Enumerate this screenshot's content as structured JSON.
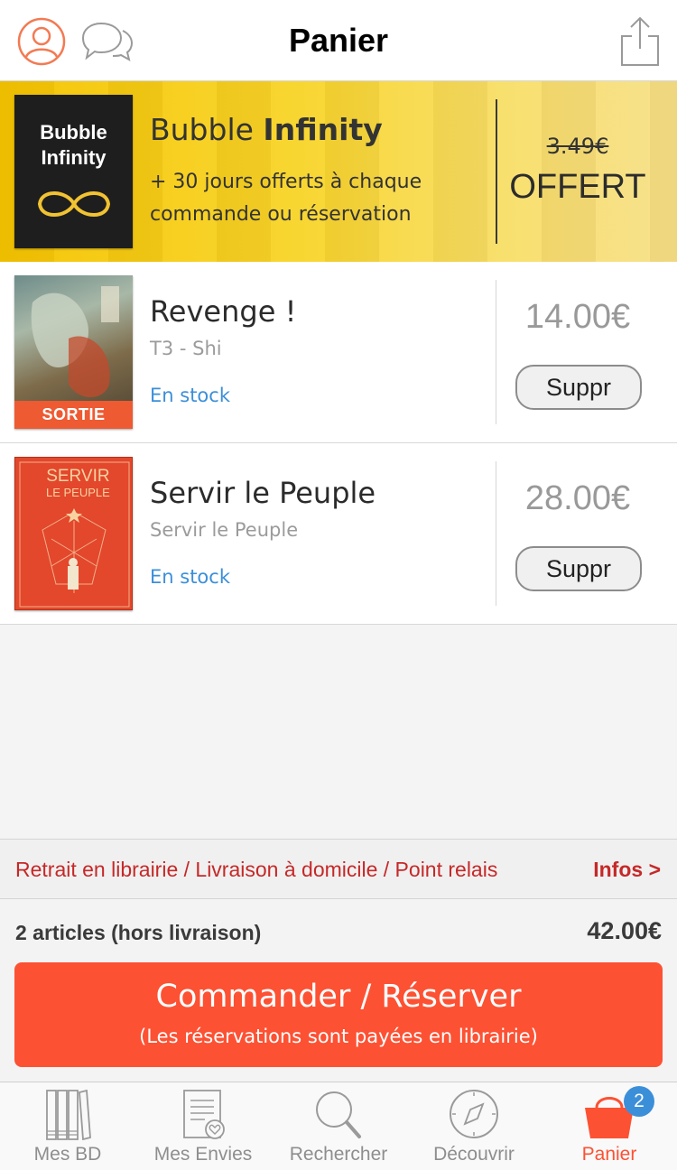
{
  "header": {
    "title": "Panier",
    "left_icons": [
      "user-icon",
      "chat-icon"
    ],
    "right_icon": "share-icon"
  },
  "promo": {
    "cover_title_line1": "Bubble",
    "cover_title_line2": "Infinity",
    "title_regular": "Bubble",
    "title_bold": "Infinity",
    "description": "+ 30 jours offerts à chaque commande ou réservation",
    "old_price": "3.49€",
    "price_label": "OFFERT"
  },
  "items": [
    {
      "title": "Revenge !",
      "subtitle": "T3 - Shi",
      "stock": "En stock",
      "price": "14.00€",
      "remove_label": "Suppr",
      "cover_badge": "SORTIE"
    },
    {
      "title": "Servir le Peuple",
      "subtitle": "Servir le Peuple",
      "stock": "En stock",
      "price": "28.00€",
      "remove_label": "Suppr",
      "cover_text_line1": "SERVIR",
      "cover_text_line2": "LE PEUPLE"
    }
  ],
  "delivery": {
    "text": "Retrait en librairie / Livraison à domicile / Point relais",
    "infos_link": "Infos >"
  },
  "summary": {
    "count": "2 articles (hors livraison)",
    "total": "42.00€"
  },
  "order_button": {
    "main": "Commander / Réserver",
    "sub": "(Les réservations sont payées en librairie)"
  },
  "tabs": [
    {
      "label": "Mes BD",
      "icon": "books-icon"
    },
    {
      "label": "Mes Envies",
      "icon": "wishlist-icon"
    },
    {
      "label": "Rechercher",
      "icon": "search-icon"
    },
    {
      "label": "Découvrir",
      "icon": "compass-icon"
    },
    {
      "label": "Panier",
      "icon": "basket-icon",
      "badge": "2",
      "active": true
    }
  ],
  "colors": {
    "accent": "#fd5133",
    "link": "#3b8fd9",
    "delivery_text": "#c62828",
    "promo_bg": "#f8d52b"
  }
}
